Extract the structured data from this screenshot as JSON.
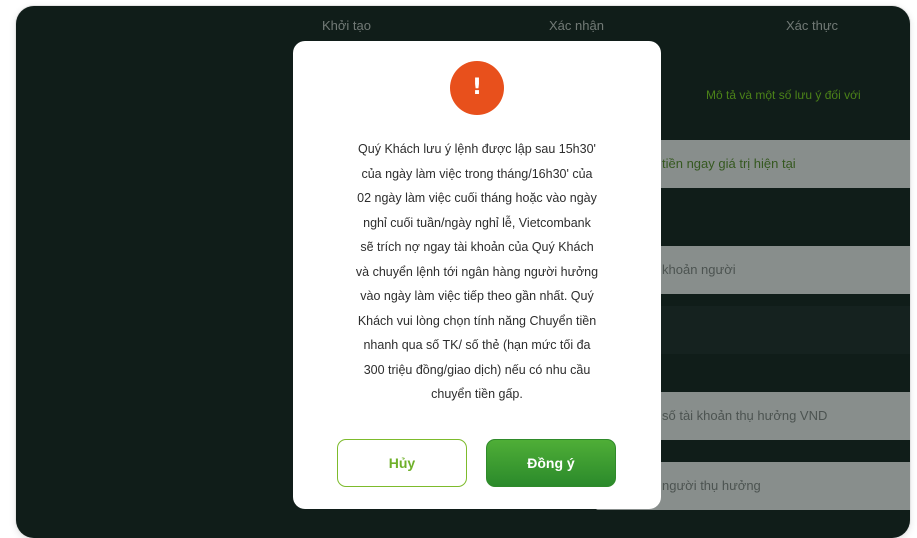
{
  "steps": [
    "Khởi tạo",
    "Xác nhận",
    "Xác thực"
  ],
  "background": {
    "note_link": "Mô tả và một số lưu ý đối với",
    "fields": [
      "tiền ngay giá trị hiện tại",
      "khoản người",
      "",
      "số tài khoản thụ hưởng VND",
      "người thụ hưởng"
    ]
  },
  "modal": {
    "icon": "exclamation-icon",
    "icon_glyph": "!",
    "message_lines": [
      "Quý Khách lưu ý lệnh được lập sau 15h30'",
      "của ngày làm việc trong tháng/16h30' của",
      "02 ngày làm việc cuối tháng hoặc vào ngày",
      "nghỉ cuối tuần/ngày nghỉ lễ, Vietcombank",
      "sẽ trích nợ ngay tài khoản của Quý Khách",
      "và chuyển lệnh tới ngân hàng người hưởng",
      "vào ngày làm việc tiếp theo gần nhất. Quý",
      "Khách vui lòng chọn tính năng Chuyển tiền",
      "nhanh qua số TK/ số thẻ (hạn mức tối đa",
      "300 triệu đồng/giao dịch) nếu có nhu cầu",
      "chuyển tiền gấp."
    ],
    "cancel_label": "Hủy",
    "confirm_label": "Đồng ý"
  },
  "colors": {
    "accent_green": "#2b8a2b",
    "alert_orange": "#e8501c",
    "backdrop": "#152420"
  }
}
